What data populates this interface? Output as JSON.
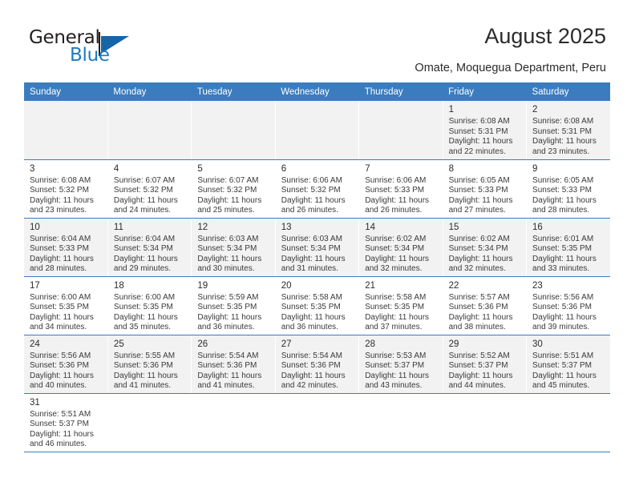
{
  "brand": {
    "name_part1": "General",
    "name_part2": "Blue",
    "accent_color": "#1565a8",
    "logo_icon": "triangle-flag-icon"
  },
  "header": {
    "title": "August 2025",
    "subtitle": "Omate, Moquegua Department, Peru"
  },
  "calendar": {
    "weekday_headers": [
      "Sunday",
      "Monday",
      "Tuesday",
      "Wednesday",
      "Thursday",
      "Friday",
      "Saturday"
    ],
    "header_bg": "#3a7cbe",
    "stripe_bg": "#f2f2f2",
    "weeks": [
      [
        {
          "day": "",
          "detail": ""
        },
        {
          "day": "",
          "detail": ""
        },
        {
          "day": "",
          "detail": ""
        },
        {
          "day": "",
          "detail": ""
        },
        {
          "day": "",
          "detail": ""
        },
        {
          "day": "1",
          "detail": "Sunrise: 6:08 AM\nSunset: 5:31 PM\nDaylight: 11 hours\nand 22 minutes."
        },
        {
          "day": "2",
          "detail": "Sunrise: 6:08 AM\nSunset: 5:31 PM\nDaylight: 11 hours\nand 23 minutes."
        }
      ],
      [
        {
          "day": "3",
          "detail": "Sunrise: 6:08 AM\nSunset: 5:32 PM\nDaylight: 11 hours\nand 23 minutes."
        },
        {
          "day": "4",
          "detail": "Sunrise: 6:07 AM\nSunset: 5:32 PM\nDaylight: 11 hours\nand 24 minutes."
        },
        {
          "day": "5",
          "detail": "Sunrise: 6:07 AM\nSunset: 5:32 PM\nDaylight: 11 hours\nand 25 minutes."
        },
        {
          "day": "6",
          "detail": "Sunrise: 6:06 AM\nSunset: 5:32 PM\nDaylight: 11 hours\nand 26 minutes."
        },
        {
          "day": "7",
          "detail": "Sunrise: 6:06 AM\nSunset: 5:33 PM\nDaylight: 11 hours\nand 26 minutes."
        },
        {
          "day": "8",
          "detail": "Sunrise: 6:05 AM\nSunset: 5:33 PM\nDaylight: 11 hours\nand 27 minutes."
        },
        {
          "day": "9",
          "detail": "Sunrise: 6:05 AM\nSunset: 5:33 PM\nDaylight: 11 hours\nand 28 minutes."
        }
      ],
      [
        {
          "day": "10",
          "detail": "Sunrise: 6:04 AM\nSunset: 5:33 PM\nDaylight: 11 hours\nand 28 minutes."
        },
        {
          "day": "11",
          "detail": "Sunrise: 6:04 AM\nSunset: 5:34 PM\nDaylight: 11 hours\nand 29 minutes."
        },
        {
          "day": "12",
          "detail": "Sunrise: 6:03 AM\nSunset: 5:34 PM\nDaylight: 11 hours\nand 30 minutes."
        },
        {
          "day": "13",
          "detail": "Sunrise: 6:03 AM\nSunset: 5:34 PM\nDaylight: 11 hours\nand 31 minutes."
        },
        {
          "day": "14",
          "detail": "Sunrise: 6:02 AM\nSunset: 5:34 PM\nDaylight: 11 hours\nand 32 minutes."
        },
        {
          "day": "15",
          "detail": "Sunrise: 6:02 AM\nSunset: 5:34 PM\nDaylight: 11 hours\nand 32 minutes."
        },
        {
          "day": "16",
          "detail": "Sunrise: 6:01 AM\nSunset: 5:35 PM\nDaylight: 11 hours\nand 33 minutes."
        }
      ],
      [
        {
          "day": "17",
          "detail": "Sunrise: 6:00 AM\nSunset: 5:35 PM\nDaylight: 11 hours\nand 34 minutes."
        },
        {
          "day": "18",
          "detail": "Sunrise: 6:00 AM\nSunset: 5:35 PM\nDaylight: 11 hours\nand 35 minutes."
        },
        {
          "day": "19",
          "detail": "Sunrise: 5:59 AM\nSunset: 5:35 PM\nDaylight: 11 hours\nand 36 minutes."
        },
        {
          "day": "20",
          "detail": "Sunrise: 5:58 AM\nSunset: 5:35 PM\nDaylight: 11 hours\nand 36 minutes."
        },
        {
          "day": "21",
          "detail": "Sunrise: 5:58 AM\nSunset: 5:35 PM\nDaylight: 11 hours\nand 37 minutes."
        },
        {
          "day": "22",
          "detail": "Sunrise: 5:57 AM\nSunset: 5:36 PM\nDaylight: 11 hours\nand 38 minutes."
        },
        {
          "day": "23",
          "detail": "Sunrise: 5:56 AM\nSunset: 5:36 PM\nDaylight: 11 hours\nand 39 minutes."
        }
      ],
      [
        {
          "day": "24",
          "detail": "Sunrise: 5:56 AM\nSunset: 5:36 PM\nDaylight: 11 hours\nand 40 minutes."
        },
        {
          "day": "25",
          "detail": "Sunrise: 5:55 AM\nSunset: 5:36 PM\nDaylight: 11 hours\nand 41 minutes."
        },
        {
          "day": "26",
          "detail": "Sunrise: 5:54 AM\nSunset: 5:36 PM\nDaylight: 11 hours\nand 41 minutes."
        },
        {
          "day": "27",
          "detail": "Sunrise: 5:54 AM\nSunset: 5:36 PM\nDaylight: 11 hours\nand 42 minutes."
        },
        {
          "day": "28",
          "detail": "Sunrise: 5:53 AM\nSunset: 5:37 PM\nDaylight: 11 hours\nand 43 minutes."
        },
        {
          "day": "29",
          "detail": "Sunrise: 5:52 AM\nSunset: 5:37 PM\nDaylight: 11 hours\nand 44 minutes."
        },
        {
          "day": "30",
          "detail": "Sunrise: 5:51 AM\nSunset: 5:37 PM\nDaylight: 11 hours\nand 45 minutes."
        }
      ],
      [
        {
          "day": "31",
          "detail": "Sunrise: 5:51 AM\nSunset: 5:37 PM\nDaylight: 11 hours\nand 46 minutes."
        },
        {
          "day": "",
          "detail": ""
        },
        {
          "day": "",
          "detail": ""
        },
        {
          "day": "",
          "detail": ""
        },
        {
          "day": "",
          "detail": ""
        },
        {
          "day": "",
          "detail": ""
        },
        {
          "day": "",
          "detail": ""
        }
      ]
    ]
  }
}
